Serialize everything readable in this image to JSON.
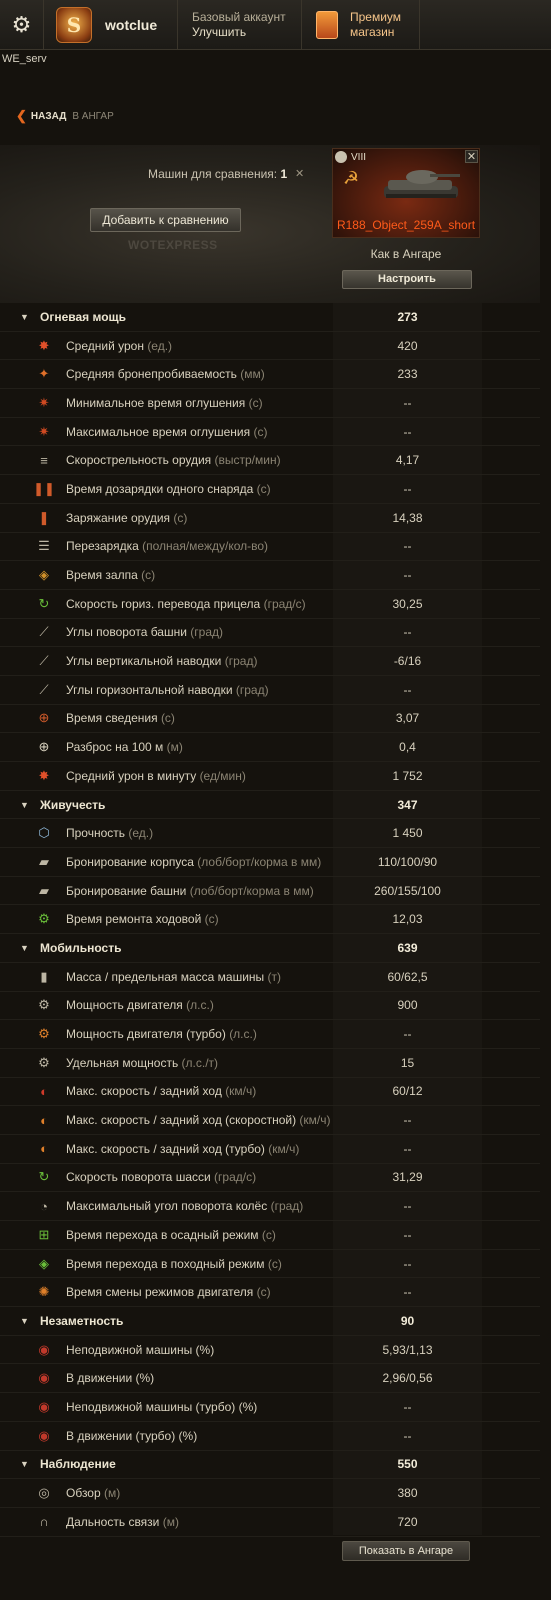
{
  "topbar": {
    "username": "wotclue",
    "badge_letter": "S",
    "account_line1": "Базовый аккаунт",
    "account_line2": "Улучшить",
    "premium_line1": "Премиум",
    "premium_line2": "магазин"
  },
  "server": "WE_serv",
  "back": {
    "label": "НАЗАД",
    "dest": "В АНГАР"
  },
  "compare": {
    "count_label": "Машин для сравнения:",
    "count_value": "1",
    "add_button": "Добавить к сравнению",
    "watermark": "WOTEXPRESS"
  },
  "vehicle": {
    "tier": "VIII",
    "name": "R188_Object_259A_short",
    "status": "Как в Ангаре",
    "configure": "Настроить"
  },
  "stats": [
    {
      "type": "cat",
      "label": "Огневая мощь",
      "value": "273"
    },
    {
      "type": "row",
      "icon": "damage-icon",
      "glyph": "✸",
      "color": "#e0502a",
      "label": "Средний урон",
      "unit": "(ед.)",
      "value": "420"
    },
    {
      "type": "row",
      "icon": "penetration-icon",
      "glyph": "✦",
      "color": "#e0702a",
      "label": "Средняя бронепробиваемость",
      "unit": "(мм)",
      "value": "233"
    },
    {
      "type": "row",
      "icon": "stun-min-icon",
      "glyph": "✷",
      "color": "#d04a22",
      "label": "Минимальное время оглушения",
      "unit": "(с)",
      "value": "--"
    },
    {
      "type": "row",
      "icon": "stun-max-icon",
      "glyph": "✷",
      "color": "#d04a22",
      "label": "Максимальное время оглушения",
      "unit": "(с)",
      "value": "--"
    },
    {
      "type": "row",
      "icon": "rate-of-fire-icon",
      "glyph": "≡",
      "color": "#bdb6a4",
      "label": "Скорострельность орудия",
      "unit": "(выстр/мин)",
      "value": "4,17"
    },
    {
      "type": "row",
      "icon": "shell-reload-icon",
      "glyph": "❚❚",
      "color": "#d05a2a",
      "label": "Время дозарядки одного снаряда",
      "unit": "(с)",
      "value": "--"
    },
    {
      "type": "row",
      "icon": "reload-icon",
      "glyph": "❚",
      "color": "#d05a2a",
      "label": "Заряжание орудия",
      "unit": "(с)",
      "value": "14,38"
    },
    {
      "type": "row",
      "icon": "clip-reload-icon",
      "glyph": "☰",
      "color": "#bdb6a4",
      "label": "Перезарядка",
      "unit": "(полная/между/кол-во)",
      "value": "--"
    },
    {
      "type": "row",
      "icon": "salvo-icon",
      "glyph": "◈",
      "color": "#d0902a",
      "label": "Время залпа",
      "unit": "(с)",
      "value": "--"
    },
    {
      "type": "row",
      "icon": "turret-traverse-icon",
      "glyph": "↻",
      "color": "#6abf3a",
      "label": "Скорость гориз. перевода прицела",
      "unit": "(град/с)",
      "value": "30,25"
    },
    {
      "type": "row",
      "icon": "turret-angles-icon",
      "glyph": "⟋",
      "color": "#bdb6a4",
      "label": "Углы поворота башни",
      "unit": "(град)",
      "value": "--"
    },
    {
      "type": "row",
      "icon": "gun-elevation-icon",
      "glyph": "⟋",
      "color": "#bdb6a4",
      "label": "Углы вертикальной наводки",
      "unit": "(град)",
      "value": "-6/16"
    },
    {
      "type": "row",
      "icon": "gun-arc-icon",
      "glyph": "⟋",
      "color": "#bdb6a4",
      "label": "Углы горизонтальной наводки",
      "unit": "(град)",
      "value": "--"
    },
    {
      "type": "row",
      "icon": "aim-time-icon",
      "glyph": "⊕",
      "color": "#d05a2a",
      "label": "Время сведения",
      "unit": "(с)",
      "value": "3,07"
    },
    {
      "type": "row",
      "icon": "dispersion-icon",
      "glyph": "⊕",
      "color": "#d8d1be",
      "label": "Разброс на 100 м",
      "unit": "(м)",
      "value": "0,4"
    },
    {
      "type": "row",
      "icon": "dpm-icon",
      "glyph": "✸",
      "color": "#e0502a",
      "label": "Средний урон в минуту",
      "unit": "(ед/мин)",
      "value": "1 752"
    },
    {
      "type": "cat",
      "label": "Живучесть",
      "value": "347"
    },
    {
      "type": "row",
      "icon": "hp-icon",
      "glyph": "⬡",
      "color": "#8fb8d8",
      "label": "Прочность",
      "unit": "(ед.)",
      "value": "1 450"
    },
    {
      "type": "row",
      "icon": "hull-armor-icon",
      "glyph": "▰",
      "color": "#bdb6a4",
      "label": "Бронирование корпуса",
      "unit": "(лоб/борт/корма в мм)",
      "value": "110/100/90"
    },
    {
      "type": "row",
      "icon": "turret-armor-icon",
      "glyph": "▰",
      "color": "#bdb6a4",
      "label": "Бронирование башни",
      "unit": "(лоб/борт/корма в мм)",
      "value": "260/155/100"
    },
    {
      "type": "row",
      "icon": "repair-icon",
      "glyph": "⚙",
      "color": "#6abf3a",
      "label": "Время ремонта ходовой",
      "unit": "(с)",
      "value": "12,03"
    },
    {
      "type": "cat",
      "label": "Мобильность",
      "value": "639"
    },
    {
      "type": "row",
      "icon": "weight-icon",
      "glyph": "▮",
      "color": "#bdb6a4",
      "label": "Масса / предельная масса машины",
      "unit": "(т)",
      "value": "60/62,5"
    },
    {
      "type": "row",
      "icon": "engine-power-icon",
      "glyph": "⚙",
      "color": "#bdb6a4",
      "label": "Мощность двигателя",
      "unit": "(л.с.)",
      "value": "900"
    },
    {
      "type": "row",
      "icon": "engine-turbo-icon",
      "glyph": "⚙",
      "color": "#e0802a",
      "label": "Мощность двигателя (турбо)",
      "unit": "(л.с.)",
      "value": "--"
    },
    {
      "type": "row",
      "icon": "power-ratio-icon",
      "glyph": "⚙",
      "color": "#bdb6a4",
      "label": "Удельная мощность",
      "unit": "(л.с./т)",
      "value": "15"
    },
    {
      "type": "row",
      "icon": "speed-icon",
      "glyph": "◐",
      "color": "#d03a2a",
      "label": "Макс. скорость / задний ход",
      "unit": "(км/ч)",
      "value": "60/12"
    },
    {
      "type": "row",
      "icon": "speed-fast-icon",
      "glyph": "◐",
      "color": "#e0802a",
      "label": "Макс. скорость / задний ход (скоростной)",
      "unit": "(км/ч)",
      "value": "--"
    },
    {
      "type": "row",
      "icon": "speed-turbo-icon",
      "glyph": "◐",
      "color": "#e0802a",
      "label": "Макс. скорость / задний ход (турбо)",
      "unit": "(км/ч)",
      "value": "--"
    },
    {
      "type": "row",
      "icon": "hull-traverse-icon",
      "glyph": "↻",
      "color": "#6abf3a",
      "label": "Скорость поворота шасси",
      "unit": "(град/с)",
      "value": "31,29"
    },
    {
      "type": "row",
      "icon": "wheel-angle-icon",
      "glyph": "◔",
      "color": "#bdb6a4",
      "label": "Максимальный угол поворота колёс",
      "unit": "(град)",
      "value": "--"
    },
    {
      "type": "row",
      "icon": "siege-mode-icon",
      "glyph": "⊞",
      "color": "#6abf3a",
      "label": "Время перехода в осадный режим ",
      "unit": "(с)",
      "value": "--"
    },
    {
      "type": "row",
      "icon": "travel-mode-icon",
      "glyph": "◈",
      "color": "#6abf3a",
      "label": "Время перехода в походный режим ",
      "unit": "(с)",
      "value": "--"
    },
    {
      "type": "row",
      "icon": "engine-mode-icon",
      "glyph": "✺",
      "color": "#e0802a",
      "label": "Время смены режимов двигателя",
      "unit": "(с)",
      "value": "--"
    },
    {
      "type": "cat",
      "label": "Незаметность",
      "value": "90"
    },
    {
      "type": "row",
      "icon": "stationary-camo-icon",
      "glyph": "◉",
      "color": "#c0392b",
      "label": "Неподвижной машины (%)",
      "unit": "",
      "value": "5,93/1,13"
    },
    {
      "type": "row",
      "icon": "moving-camo-icon",
      "glyph": "◉",
      "color": "#c0392b",
      "label": "В движении (%)",
      "unit": "",
      "value": "2,96/0,56"
    },
    {
      "type": "row",
      "icon": "stationary-camo-turbo-icon",
      "glyph": "◉",
      "color": "#c0392b",
      "label": "Неподвижной машины (турбо) (%)",
      "unit": "",
      "value": "--"
    },
    {
      "type": "row",
      "icon": "moving-camo-turbo-icon",
      "glyph": "◉",
      "color": "#c0392b",
      "label": "В движении (турбо) (%)",
      "unit": "",
      "value": "--"
    },
    {
      "type": "cat",
      "label": "Наблюдение",
      "value": "550"
    },
    {
      "type": "row",
      "icon": "view-range-icon",
      "glyph": "◎",
      "color": "#bdb6a4",
      "label": "Обзор",
      "unit": "(м)",
      "value": "380"
    },
    {
      "type": "row",
      "icon": "radio-range-icon",
      "glyph": "∩",
      "color": "#bdb6a4",
      "label": "Дальность связи",
      "unit": "(м)",
      "value": "720"
    }
  ],
  "footer": {
    "show_in_hangar": "Показать в Ангаре"
  }
}
